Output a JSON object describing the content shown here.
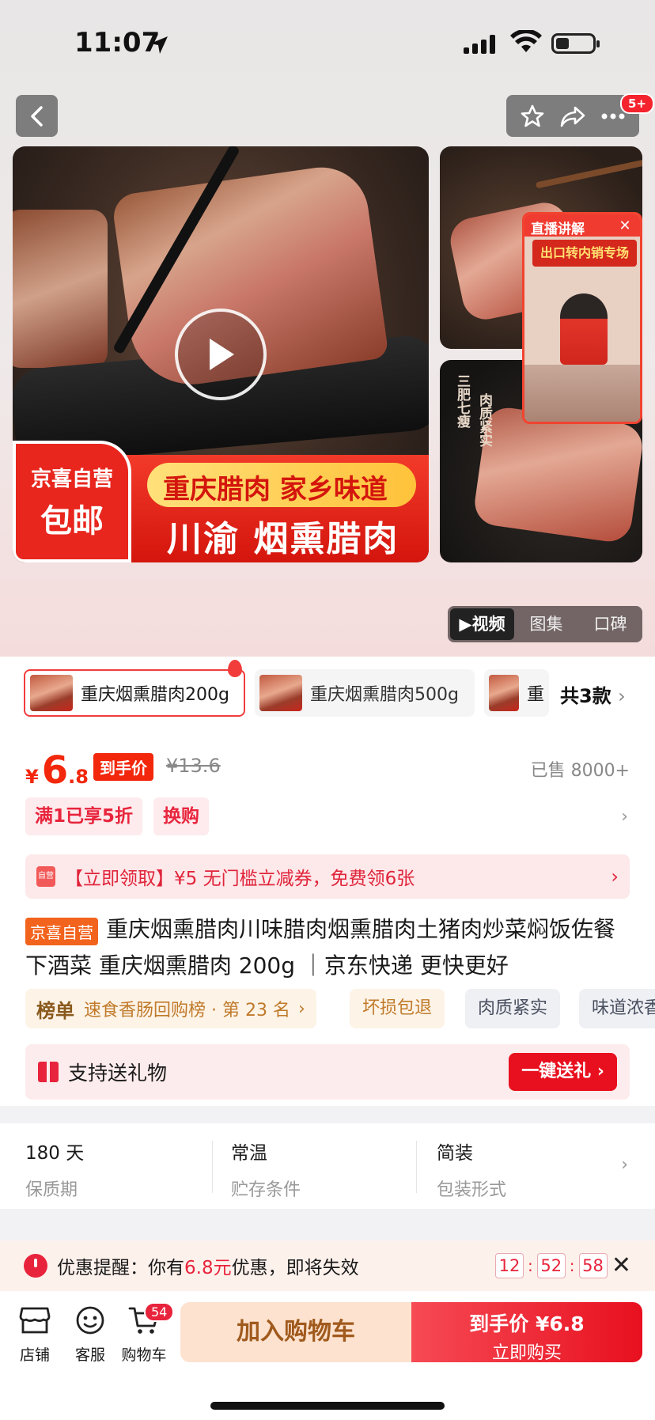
{
  "status_bar": {
    "time": "11:07"
  },
  "nav": {
    "more_badge": "5+"
  },
  "gallery": {
    "main_tag_line1": "京喜自营",
    "main_tag_line2": "包邮",
    "slogan": "重庆腊肉 家乡味道",
    "title": "川渝 烟熏腊肉",
    "side_text1": "三肥七瘦",
    "side_text2": "肉质紧实",
    "live_title": "直播讲解",
    "live_subtitle": "出口转内销专场",
    "tabs": [
      "视频",
      "图集",
      "口碑"
    ],
    "active_tab": "视频"
  },
  "skus": {
    "items": [
      "重庆烟熏腊肉200g",
      "重庆烟熏腊肉500g",
      "重"
    ],
    "total": "共3款"
  },
  "price": {
    "yen": "¥",
    "integer": "6",
    "decimal": ".8",
    "deal_label": "到手价",
    "old_price": "¥13.6",
    "sold": "已售 8000+"
  },
  "promos": [
    "满1已享5折",
    "换购"
  ],
  "coupon": {
    "text": "【立即领取】¥5 无门槛立减券，免费领6张",
    "icon_label": "自营"
  },
  "product": {
    "self_tag": "京喜自营",
    "title": "重庆烟熏腊肉川味腊肉烟熏腊肉土猪肉炒菜焖饭佐餐下酒菜 重庆烟熏腊肉 200g ｜京东快递 更快更好"
  },
  "ranking": {
    "badge": "榜单",
    "text": "速食香肠回购榜 · 第 23 名"
  },
  "chips": [
    "坏损包退",
    "肉质紧实",
    "味道浓香"
  ],
  "gift": {
    "label": "支持送礼物",
    "button": "一键送礼"
  },
  "specs": [
    {
      "value": "180 天",
      "label": "保质期"
    },
    {
      "value": "常温",
      "label": "贮存条件"
    },
    {
      "value": "简装",
      "label": "包装形式"
    }
  ],
  "reminder": {
    "prefix": "优惠提醒：你有",
    "amount": "6.8元",
    "suffix": "优惠，即将失效",
    "hh": "12",
    "mm": "52",
    "ss": "58"
  },
  "bottom_bar": {
    "shop": "店铺",
    "service": "客服",
    "cart": "购物车",
    "cart_count": "54",
    "add_to_cart": "加入购物车",
    "buy_line1": "到手价 ¥6.8",
    "buy_line2": "立即购买"
  },
  "colors": {
    "accent_red": "#f2270c",
    "buy_red": "#e8101f",
    "cart_peach": "#fde2cf"
  }
}
